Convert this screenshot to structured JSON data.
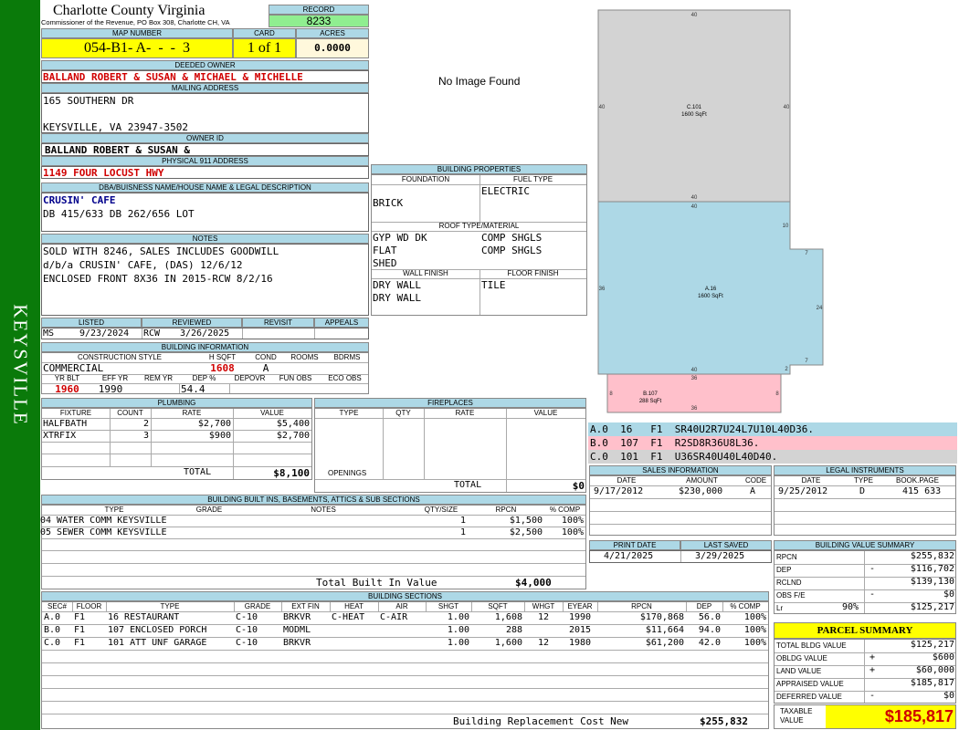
{
  "side_label": "KEYSVILLE",
  "header": {
    "title": "Charlotte County Virginia",
    "subtitle": "Commissioner of the Revenue, PO Box 308, Charlotte CH, VA",
    "record_label": "RECORD",
    "record": "8233",
    "map_label": "MAP NUMBER",
    "map_number": "054-B1- A-  -  -  3",
    "card_label": "CARD",
    "card": "1 of 1",
    "acres_label": "ACRES",
    "acres": "0.0000"
  },
  "owner": {
    "deeded_label": "DEEDED OWNER",
    "deeded_owner": "BALLAND ROBERT & SUSAN & MICHAEL & MICHELLE",
    "mailing_label": "MAILING ADDRESS",
    "mail_line1": "165 SOUTHERN DR",
    "mail_line2": "KEYSVILLE, VA 23947-3502",
    "owner_id_label": "OWNER ID",
    "owner_id": "BALLAND ROBERT & SUSAN &",
    "physical_label": "PHYSICAL 911 ADDRESS",
    "physical": "1149 FOUR LOCUST HWY"
  },
  "dba": {
    "label": "DBA/BUISNESS NAME/HOUSE NAME & LEGAL DESCRIPTION",
    "name": "CRUSIN' CAFE",
    "legal": "DB 415/633 DB 262/656 LOT"
  },
  "notes": {
    "label": "NOTES",
    "lines": [
      "SOLD WITH 8246, SALES INCLUDES GOODWILL",
      "d/b/a CRUSIN' CAFE, (DAS) 12/6/12",
      "ENCLOSED FRONT 8X36 IN 2015-RCW 8/2/16"
    ]
  },
  "listed": {
    "listed_label": "LISTED",
    "reviewed_label": "REVIEWED",
    "revisit_label": "REVISIT",
    "appeals_label": "APPEALS",
    "listed_by": "MS",
    "listed_date": "9/23/2024",
    "reviewed_by": "RCW",
    "reviewed_date": "3/26/2025"
  },
  "bldg_info": {
    "label": "BUILDING INFORMATION",
    "cs_label": "CONSTRUCTION STYLE",
    "hsqft_label": "H SQFT",
    "cond_label": "COND",
    "rooms_label": "ROOMS",
    "bdrms_label": "BDRMS",
    "style": "COMMERCIAL",
    "hsqft": "1608",
    "cond": "A",
    "yrblt_label": "YR BLT",
    "effyr_label": "EFF YR",
    "remyr_label": "REM YR",
    "dep_label": "DEP %",
    "depovr_label": "DEPOVR",
    "funobs_label": "FUN OBS",
    "ecoobs_label": "ECO OBS",
    "yr_blt": "1960",
    "eff_yr": "1990",
    "dep": "54.4"
  },
  "photo": {
    "text": "No Image Found"
  },
  "props": {
    "label": "BUILDING PROPERTIES",
    "foundation_label": "FOUNDATION",
    "fuel_label": "FUEL TYPE",
    "foundation": "BRICK",
    "fuel": "ELECTRIC",
    "roof_label": "ROOF TYPE/MATERIAL",
    "roof_type": [
      "GYP WD DK",
      "FLAT",
      "SHED"
    ],
    "roof_mat": [
      "COMP SHGLS",
      "COMP SHGLS"
    ],
    "wall_label": "WALL FINISH",
    "floor_label": "FLOOR FINISH",
    "wall": [
      "DRY WALL",
      "DRY WALL"
    ],
    "floor": "TILE"
  },
  "plumbing": {
    "label": "PLUMBING",
    "h_fixture": "FIXTURE",
    "h_count": "COUNT",
    "h_rate": "RATE",
    "h_value": "VALUE",
    "rows": [
      {
        "fixture": "HALFBATH",
        "count": "2",
        "rate": "$2,700",
        "value": "$5,400"
      },
      {
        "fixture": "XTRFIX",
        "count": "3",
        "rate": "$900",
        "value": "$2,700"
      }
    ],
    "total_label": "TOTAL",
    "total": "$8,100"
  },
  "fireplaces": {
    "label": "FIREPLACES",
    "h_type": "TYPE",
    "h_qty": "QTY",
    "h_rate": "RATE",
    "h_value": "VALUE",
    "openings_label": "OPENINGS",
    "total_label": "TOTAL",
    "total": "$0"
  },
  "builtins": {
    "label": "BUILDING BUILT INS, BASEMENTS, ATTICS & SUB SECTIONS",
    "h_type": "TYPE",
    "h_grade": "GRADE",
    "h_notes": "NOTES",
    "h_qty": "QTY/SIZE",
    "h_rpcn": "RPCN",
    "h_comp": "% COMP",
    "rows": [
      {
        "type": "04 WATER COMM KEYSVILLE",
        "qty": "1",
        "rpcn": "$1,500",
        "comp": "100%"
      },
      {
        "type": "05 SEWER COMM KEYSVILLE",
        "qty": "1",
        "rpcn": "$2,500",
        "comp": "100%"
      }
    ],
    "total_label": "Total Built In Value",
    "total": "$4,000"
  },
  "sections": {
    "label": "BUILDING SECTIONS",
    "headers": [
      "SEC#",
      "FLOOR",
      "TYPE",
      "GRADE",
      "EXT FIN",
      "HEAT",
      "AIR",
      "SHGT",
      "SQFT",
      "WHGT",
      "EYEAR",
      "RPCN",
      "DEP",
      "% COMP"
    ],
    "rows": [
      [
        "A.0",
        "F1",
        "16 RESTAURANT",
        "C-10",
        "BRKVR",
        "C-HEAT",
        "C-AIR",
        "1.00",
        "1,608",
        "12",
        "1990",
        "$170,868",
        "56.0",
        "100%"
      ],
      [
        "B.0",
        "F1",
        "107 ENCLOSED PORCH",
        "C-10",
        "MODML",
        "",
        "",
        "1.00",
        "288",
        "",
        "2015",
        "$11,664",
        "94.0",
        "100%"
      ],
      [
        "C.0",
        "F1",
        "101 ATT UNF GARAGE",
        "C-10",
        "BRKVR",
        "",
        "",
        "1.00",
        "1,600",
        "12",
        "1980",
        "$61,200",
        "42.0",
        "100%"
      ]
    ],
    "brcn_label": "Building Replacement Cost New",
    "brcn": "$255,832"
  },
  "sketch": {
    "a_label": "A.16",
    "a_sqft": "1600 SqFt",
    "b_label": "B.107",
    "b_sqft": "288 SqFt",
    "c_label": "C.101",
    "c_sqft": "1600 SqFt",
    "dims": [
      "40",
      "40",
      "40",
      "40",
      "40",
      "40",
      "10",
      "7",
      "24",
      "7",
      "2",
      "36",
      "36",
      "36",
      "8",
      "8",
      "36"
    ],
    "vectors": [
      {
        "text": "A.0  16   F1  SR40U2R7U24L7U10L40D36.",
        "color": "#add8e6"
      },
      {
        "text": "B.0  107  F1  R2SD8R36U8L36.",
        "color": "#ffc0cb"
      },
      {
        "text": "C.0  101  F1  U36SR40U40L40D40.",
        "color": "#d3d3d3"
      }
    ]
  },
  "sales": {
    "label": "SALES INFORMATION",
    "h_date": "DATE",
    "h_amount": "AMOUNT",
    "h_code": "CODE",
    "date": "9/17/2012",
    "amount": "$230,000",
    "code": "A"
  },
  "legal": {
    "label": "LEGAL INSTRUMENTS",
    "h_date": "DATE",
    "h_type": "TYPE",
    "h_book": "BOOK.PAGE",
    "date": "9/25/2012",
    "type": "D",
    "book": "415 633"
  },
  "dates": {
    "print_label": "PRINT DATE",
    "saved_label": "LAST SAVED",
    "print_date": "4/21/2025",
    "last_saved": "3/29/2025"
  },
  "bvs": {
    "label": "BUILDING VALUE SUMMARY",
    "rows": [
      {
        "label": "RPCN",
        "sign": "",
        "pct": "",
        "value": "$255,832"
      },
      {
        "label": "DEP",
        "sign": "-",
        "pct": "",
        "value": "$116,702"
      },
      {
        "label": "RCLND",
        "sign": "",
        "pct": "",
        "value": "$139,130"
      },
      {
        "label": "OBS F/E",
        "sign": "-",
        "pct": "",
        "value": "$0"
      },
      {
        "label": "Lr",
        "sign": "",
        "pct": "90%",
        "value": "$125,217"
      }
    ]
  },
  "parcel": {
    "label": "PARCEL SUMMARY",
    "rows": [
      {
        "label": "TOTAL BLDG VALUE",
        "sign": "",
        "value": "$125,217"
      },
      {
        "label": "OBLDG VALUE",
        "sign": "+",
        "value": "$600"
      },
      {
        "label": "LAND VALUE",
        "sign": "+",
        "value": "$60,000"
      },
      {
        "label": "APPRAISED VALUE",
        "sign": "",
        "value": "$185,817"
      },
      {
        "label": "DEFERRED VALUE",
        "sign": "-",
        "value": "$0"
      }
    ],
    "taxable_label": "TAXABLE VALUE",
    "taxable": "$185,817"
  },
  "colors": {
    "sidebar": "#0a7a0a",
    "header_bg": "#add8e6",
    "yellow": "#ffff00",
    "green": "#90ee90",
    "red": "#d00000",
    "section_a": "#add8e6",
    "section_b": "#ffc0cb",
    "section_c": "#d3d3d3"
  }
}
